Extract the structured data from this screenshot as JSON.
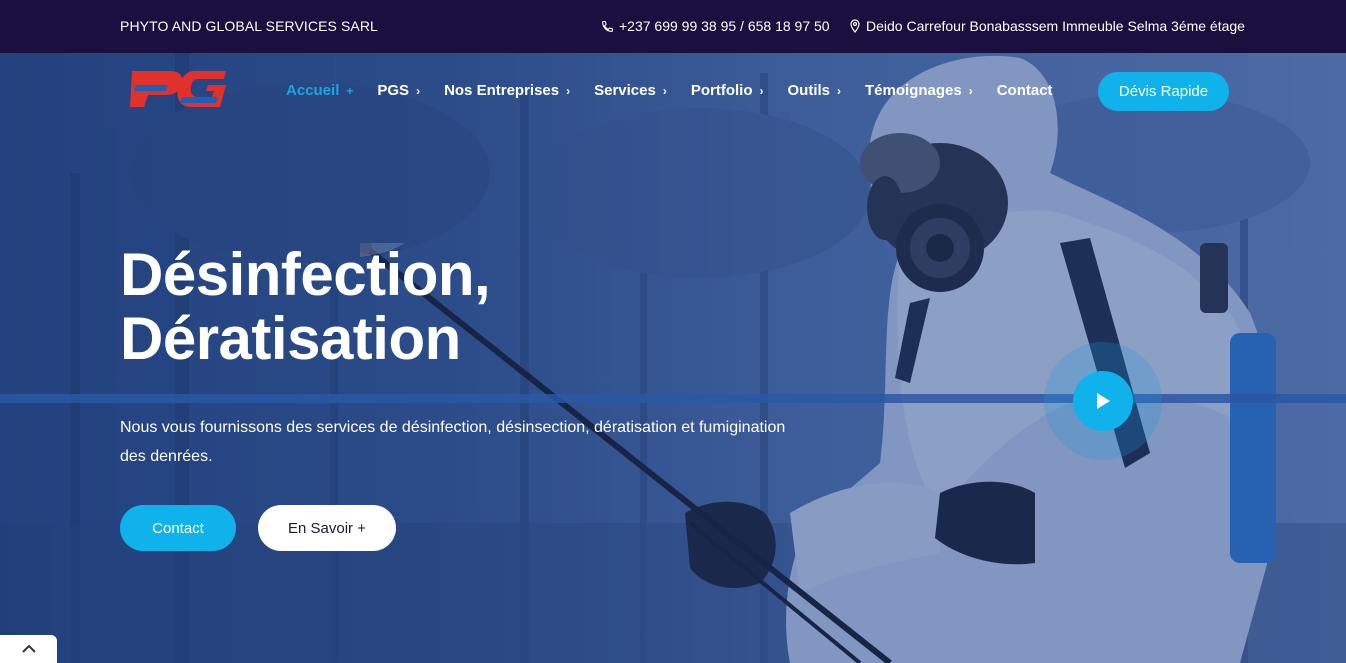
{
  "topbar": {
    "company": "PHYTO AND GLOBAL SERVICES SARL",
    "phone": "+237 699 99 38 95 / 658 18 97 50",
    "phone_icon": "phone-icon",
    "address": "Deido Carrefour Bonabasssem Immeuble Selma 3éme étage",
    "address_icon": "location-pin-icon"
  },
  "header": {
    "logo_text": "PG",
    "nav": [
      {
        "label": "Accueil",
        "suffix": "+",
        "active": true
      },
      {
        "label": "PGS",
        "suffix": "›"
      },
      {
        "label": "Nos Entreprises",
        "suffix": "›"
      },
      {
        "label": "Services",
        "suffix": "›"
      },
      {
        "label": "Portfolio",
        "suffix": "›"
      },
      {
        "label": "Outils",
        "suffix": "›"
      },
      {
        "label": "Témoignages",
        "suffix": "›"
      },
      {
        "label": "Contact",
        "suffix": ""
      }
    ],
    "cta_label": "Dévis Rapide"
  },
  "hero": {
    "title_line1": "Désinfection,",
    "title_line2": "Dératisation",
    "description": "Nous vous fournissons des services de désinfection, désinsection, dératisation et fumigination des denrées.",
    "primary_button": "Contact",
    "secondary_button": "En Savoir +"
  },
  "colors": {
    "topbar_bg": "#1a0f3f",
    "accent": "#0fb2ea",
    "logo_red": "#e2312a",
    "logo_blue": "#1f5fb6"
  },
  "icons": {
    "play": "play-icon",
    "back_to_top": "chevron-up-icon"
  }
}
